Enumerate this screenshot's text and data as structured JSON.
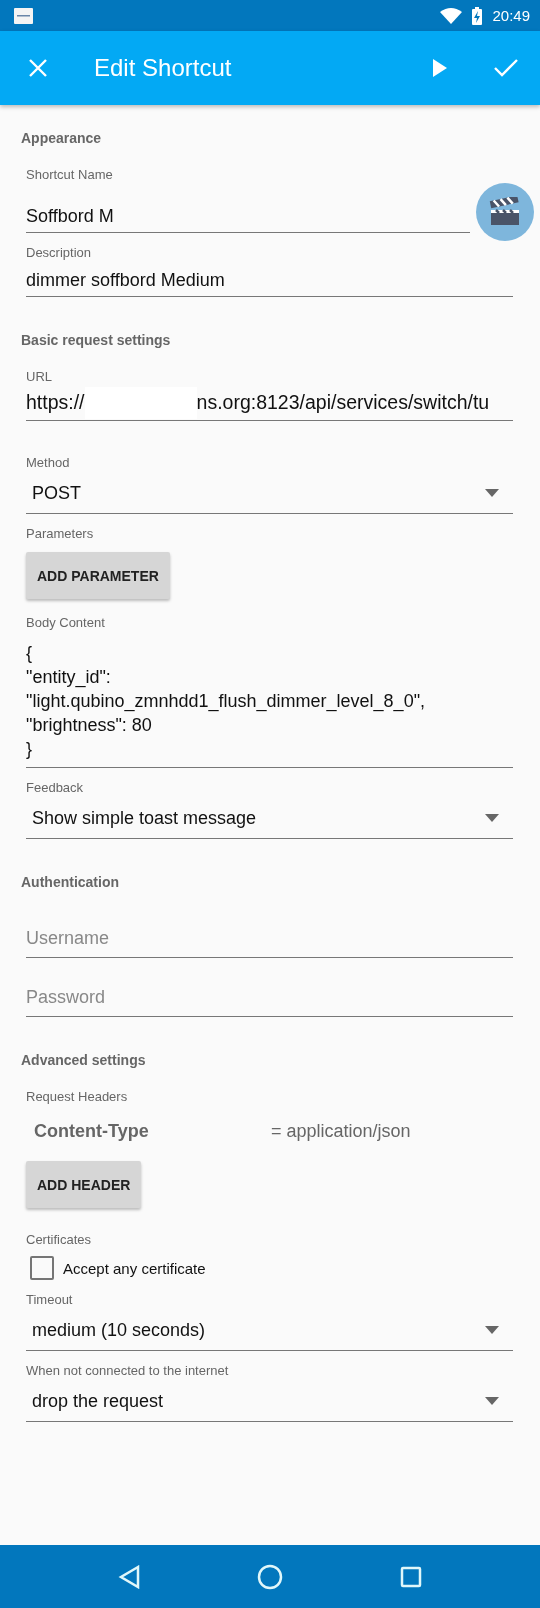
{
  "status_bar": {
    "time": "20:49"
  },
  "app_bar": {
    "title": "Edit Shortcut"
  },
  "sections": [
    {
      "title": "Appearance",
      "items": [
        {
          "kind": "name",
          "label": "Shortcut Name",
          "value": "Soffbord M"
        },
        {
          "kind": "text",
          "label": "Description",
          "value": "dimmer soffbord Medium"
        }
      ]
    },
    {
      "title": "Basic request settings",
      "items": [
        {
          "kind": "url",
          "label": "URL",
          "prefix": "https://",
          "suffix": "ns.org:8123/api/services/switch/tu"
        },
        {
          "kind": "dropdown",
          "label": "Method",
          "value": "POST"
        },
        {
          "kind": "button",
          "label": "Parameters",
          "button": "ADD PARAMETER"
        },
        {
          "kind": "body",
          "label": "Body Content",
          "value": "{\n\"entity_id\":\n\"light.qubino_zmnhdd1_flush_dimmer_level_8_0\",\n\"brightness\": 80\n}"
        },
        {
          "kind": "dropdown",
          "label": "Feedback",
          "value": "Show simple toast message"
        }
      ]
    },
    {
      "title": "Authentication",
      "items": [
        {
          "kind": "input",
          "placeholder": "Username"
        },
        {
          "kind": "input",
          "placeholder": "Password"
        }
      ]
    },
    {
      "title": "Advanced settings",
      "items": [
        {
          "kind": "headers",
          "label": "Request Headers",
          "headers": [
            {
              "name": "Content-Type",
              "value": "= application/json"
            }
          ],
          "button": "ADD HEADER"
        },
        {
          "kind": "checkbox",
          "label": "Certificates",
          "text": "Accept any certificate",
          "checked": false
        },
        {
          "kind": "dropdown",
          "label": "Timeout",
          "value": "medium (10 seconds)"
        },
        {
          "kind": "dropdown",
          "label": "When not connected to the internet",
          "value": "drop the request"
        }
      ]
    }
  ]
}
